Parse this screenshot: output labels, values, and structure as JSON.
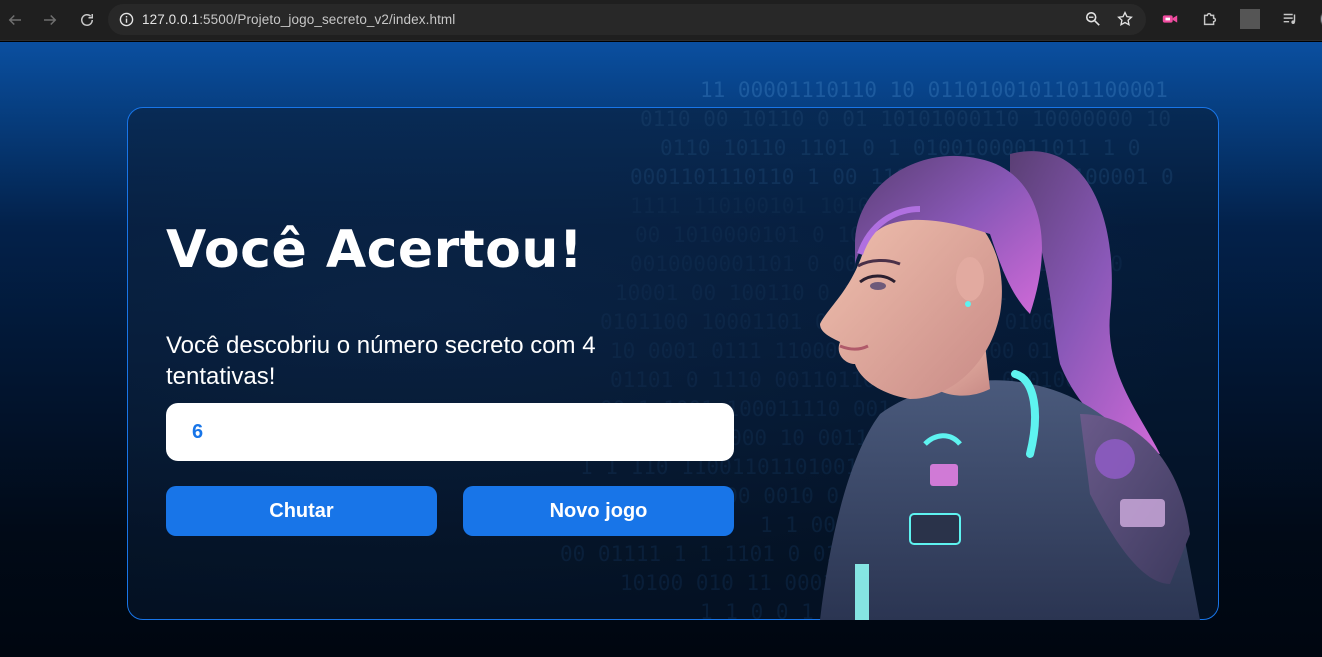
{
  "browser": {
    "url_host": "127.0.0.1",
    "url_path": ":5500/Projeto_jogo_secreto_v2/index.html"
  },
  "game": {
    "title": "Você Acertou!",
    "message": "Você descobriu o número secreto com 4 tentativas!",
    "input_value": "6",
    "guess_button": "Chutar",
    "new_game_button": "Novo jogo"
  },
  "background": {
    "binary_lines": [
      "11 00001110110 10 0110100101101100001",
      "0110 00 10110 0 01 10101000110 10000000 10",
      "0110 10110 1101 0 1 01001000011011 1 0",
      "0001101110110 1 00 1101011 11  10110100001 0",
      "1111  110100101  1010110 1100000011 0 0",
      "00 1010000101 0 10100110 1 1 0 001011",
      "0010000001101 0  001 100101 100 11 100 0",
      "10001 00 100110 0 1 10 1011 011 0 1 1",
      "0101100 10001101 0 000110 1 0 1 0100011",
      "10 0001 0111 1100011001111 00000 01 1",
      "01101 0 1110 00110110100 1 0 1 0 0100",
      "00 1 1001 100011110 001 000 1 10 0110",
      "0 000 01101000 10 0011011 0 11 0 1",
      "1 1 110 11001101101001 0 101001 11 0",
      "0000 0010 0 0 00000 01 1 0 1 1 0",
      "1 1 0011 001 0 0 1 0 0 1 0",
      "00 01111 1 1 1101 0 01 1 0 0 0",
      "10100 010 11 0001 1 0 10 1 0 1 1",
      "1 1 0 0 1 1 0 1"
    ]
  },
  "colors": {
    "accent": "#1875e8",
    "card_border": "#1875e8",
    "text": "#ffffff"
  }
}
